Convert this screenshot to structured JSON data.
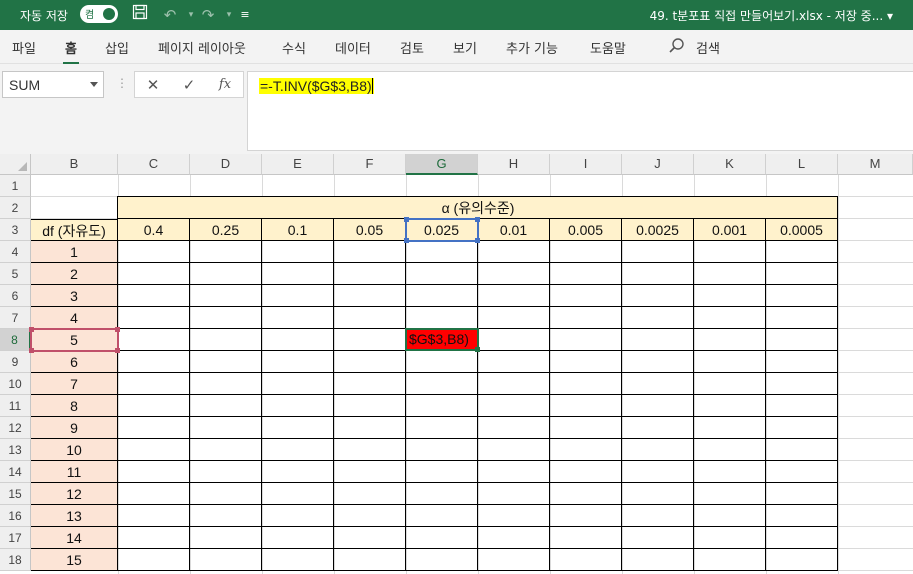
{
  "titlebar": {
    "autosave_label": "자동 저장",
    "autosave_state": "켬",
    "filename": "49. t분포표 직접 만들어보기.xlsx  -  저장 중... ▾"
  },
  "ribbon": {
    "tabs": [
      "파일",
      "홈",
      "삽입",
      "페이지 레이아웃",
      "수식",
      "데이터",
      "검토",
      "보기",
      "추가 기능",
      "도움말"
    ],
    "active_tab": "홈",
    "search_label": "검색"
  },
  "formula": {
    "namebox": "SUM",
    "content": "=-T.INV($G$3,B8)"
  },
  "sheet": {
    "columns": [
      "B",
      "C",
      "D",
      "E",
      "F",
      "G",
      "H",
      "I",
      "J",
      "K",
      "L",
      "M"
    ],
    "selected_column": "G",
    "rows": [
      "1",
      "2",
      "3",
      "4",
      "5",
      "6",
      "7",
      "8",
      "9",
      "10",
      "11",
      "12",
      "13",
      "14",
      "15",
      "16",
      "17",
      "18"
    ],
    "selected_row": "8",
    "alpha_header": "α (유의수준)",
    "df_header": "df (자유도)",
    "alpha_values": [
      "0.4",
      "0.25",
      "0.1",
      "0.05",
      "0.025",
      "0.01",
      "0.005",
      "0.0025",
      "0.001",
      "0.0005"
    ],
    "df_values": [
      "1",
      "2",
      "3",
      "4",
      "5",
      "6",
      "7",
      "8",
      "9",
      "10",
      "11",
      "12",
      "13",
      "14",
      "15"
    ],
    "editing_cell_text": "$G$3,B8)",
    "editing_cell_color": "#ff0000"
  }
}
